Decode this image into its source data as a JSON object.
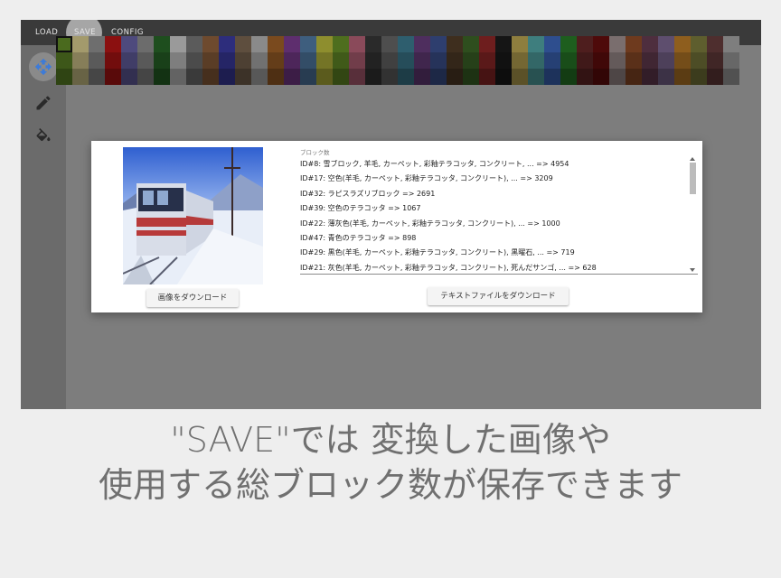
{
  "menu": {
    "items": [
      "LOAD",
      "SAVE",
      "CONFIG"
    ],
    "active": "SAVE"
  },
  "toolbar": {
    "tools": [
      "move-icon",
      "pencil-icon",
      "fill-icon"
    ],
    "active": "move-icon",
    "accent": "#3d7bd8"
  },
  "palette": {
    "colors": [
      "#4a6a1e",
      "#a39a6c",
      "#6e6e6e",
      "#8b1010",
      "#4e4a7d",
      "#6c6c6c",
      "#1e4e1e",
      "#9a9a9a",
      "#5b5b5b",
      "#6e4a2e",
      "#2d2d7c",
      "#5e4e3e",
      "#8a8a8a",
      "#7a4a1e",
      "#5e2e6e",
      "#3e5e7e",
      "#8e8e2e",
      "#4e6e1e",
      "#8a4a5a",
      "#2a2a2a",
      "#4e4e4e",
      "#2e5e6e",
      "#4e2e5e",
      "#2e3e6e",
      "#3e2e1e",
      "#2e4e1e",
      "#6e1e1e",
      "#151515",
      "#8e7e3e",
      "#3e7e7e",
      "#2e4e8e",
      "#1e5e1e",
      "#4e1e1e",
      "#4e0a0a",
      "#7a6e6e",
      "#6e3a1e",
      "#4e2e3e",
      "#5e4e6e",
      "#8e5e1e",
      "#5e5e2e",
      "#4e2e2e",
      "#7e7e7e"
    ],
    "selected_index": 0
  },
  "dialog": {
    "image_label": "preview-image",
    "download_image_label": "画像をダウンロード",
    "download_text_label": "テキストファイルをダウンロード",
    "count_label": "ブロック数",
    "count_lines": [
      "ID#8: 雪ブロック, 羊毛, カーペット, 彩釉テラコッタ, コンクリート, ... => 4954",
      "ID#17: 空色(羊毛, カーペット, 彩釉テラコッタ, コンクリート), ... => 3209",
      "ID#32: ラピスラズリブロック => 2691",
      "ID#39: 空色のテラコッタ => 1067",
      "ID#22: 薄灰色(羊毛, カーペット, 彩釉テラコッタ, コンクリート), ... => 1000",
      "ID#47: 青色のテラコッタ => 898",
      "ID#29: 黒色(羊毛, カーペット, 彩釉テラコッタ, コンクリート), 黒曜石, ... => 719",
      "ID#21: 灰色(羊毛, カーペット, 彩釉テラコッタ, コンクリート), 死んだサンゴ, ... => 628"
    ],
    "scroll_position": 0.05
  },
  "caption": {
    "line1": "\"SAVE\"では 変換した画像や",
    "line2": "使用する総ブロック数が保存できます"
  }
}
